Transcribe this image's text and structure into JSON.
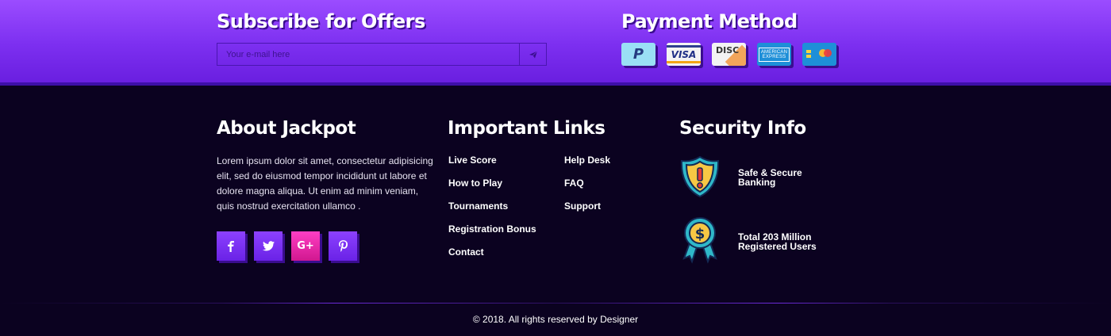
{
  "subscribe": {
    "title": "Subscribe for Offers",
    "email_placeholder": "Your e-mail here",
    "send_icon": "send-icon"
  },
  "payment": {
    "title": "Payment Method",
    "cards": [
      {
        "name": "PayPal",
        "label": "P",
        "icon": "paypal-icon"
      },
      {
        "name": "Visa",
        "label": "VISA",
        "icon": "visa-icon"
      },
      {
        "name": "Discover",
        "label": "DISC",
        "icon": "discover-icon"
      },
      {
        "name": "American Express",
        "label_line1": "AMERICAN",
        "label_line2": "EXPRESS",
        "icon": "amex-icon"
      },
      {
        "name": "Mastercard",
        "icon": "mastercard-icon"
      }
    ]
  },
  "about": {
    "title": "About Jackpot",
    "text": "Lorem ipsum dolor sit amet, consectetur adipisicing elit, sed do eiusmod tempor incididunt ut labore et dolore magna aliqua. Ut enim ad minim veniam, quis nostrud exercitation ullamco .",
    "socials": [
      {
        "label": "f",
        "icon": "facebook-icon"
      },
      {
        "label": "twitter",
        "icon": "twitter-icon"
      },
      {
        "label": "G+",
        "icon": "google-plus-icon"
      },
      {
        "label": "P",
        "icon": "pinterest-icon"
      }
    ]
  },
  "links": {
    "title": "Important Links",
    "col1": [
      "Live Score",
      "How to Play",
      "Tournaments",
      "Registration Bonus",
      "Contact"
    ],
    "col2": [
      "Help Desk",
      "FAQ",
      "Support"
    ]
  },
  "security": {
    "title": "Security Info",
    "items": [
      {
        "line1": "Safe & Secure",
        "line2": "Banking",
        "icon": "shield-warning-icon"
      },
      {
        "line1": "Total 203 Million",
        "line2": "Registered Users",
        "icon": "dollar-badge-icon"
      }
    ]
  },
  "footer": {
    "copyright": "© 2018. All rights reserved by Designer"
  },
  "colors": {
    "band_top": "#9b4cff",
    "band_bottom": "#6a1fe0",
    "background": "#0b0220",
    "accent_pink": "#ff3fc4"
  }
}
